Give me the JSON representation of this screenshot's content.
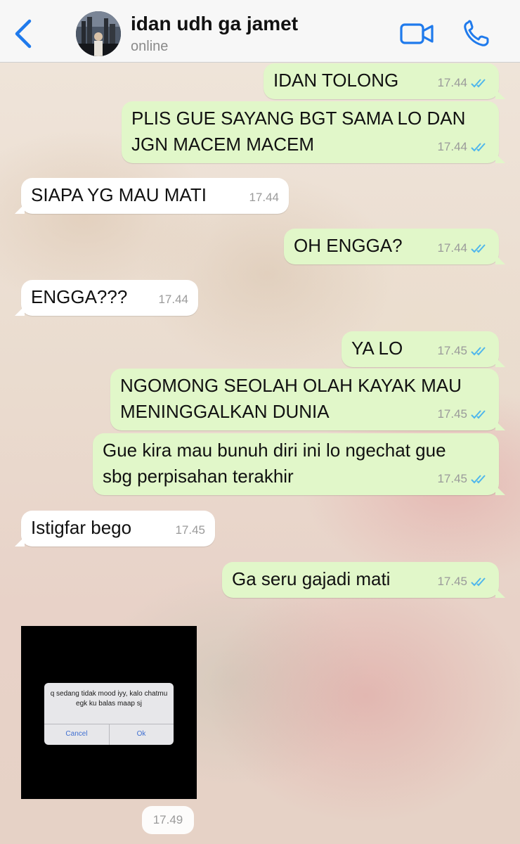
{
  "header": {
    "contact_name": "idan udh ga jamet",
    "contact_status": "online"
  },
  "messages": [
    {
      "dir": "out",
      "text": "IDAN TOLONG",
      "time": "17.44",
      "read": true
    },
    {
      "dir": "out",
      "text": "PLIS GUE SAYANG BGT SAMA LO DAN\nJGN MACEM MACEM",
      "time": "17.44",
      "read": true
    },
    {
      "dir": "in",
      "text": "SIAPA YG MAU MATI",
      "time": "17.44"
    },
    {
      "dir": "out",
      "text": "OH ENGGA?",
      "time": "17.44",
      "read": true
    },
    {
      "dir": "in",
      "text": "ENGGA???",
      "time": "17.44"
    },
    {
      "dir": "out",
      "text": "YA LO",
      "time": "17.45",
      "read": true
    },
    {
      "dir": "out",
      "text": "NGOMONG SEOLAH OLAH KAYAK MAU\nMENINGGALKAN DUNIA",
      "time": "17.45",
      "read": true
    },
    {
      "dir": "out",
      "text": "Gue kira mau bunuh diri ini lo ngechat gue\nsbg perpisahan terakhir",
      "time": "17.45",
      "read": true
    },
    {
      "dir": "in",
      "text": "Istigfar bego",
      "time": "17.45"
    },
    {
      "dir": "out",
      "text": "Ga seru gajadi mati",
      "time": "17.45",
      "read": true
    }
  ],
  "image_message": {
    "dir": "in",
    "alert_text": "q sedang tidak mood iyy, kalo chatmu egk ku balas maap sj",
    "alert_cancel": "Cancel",
    "alert_ok": "Ok",
    "time": "17.49"
  },
  "colors": {
    "outgoing_bubble": "#e1f7c9",
    "incoming_bubble": "#ffffff",
    "accent_blue": "#1f7aec",
    "read_check": "#4fb6ec"
  },
  "icons": {
    "back": "chevron-left-icon",
    "video": "video-camera-icon",
    "call": "phone-icon",
    "read_receipt": "double-check-icon"
  }
}
